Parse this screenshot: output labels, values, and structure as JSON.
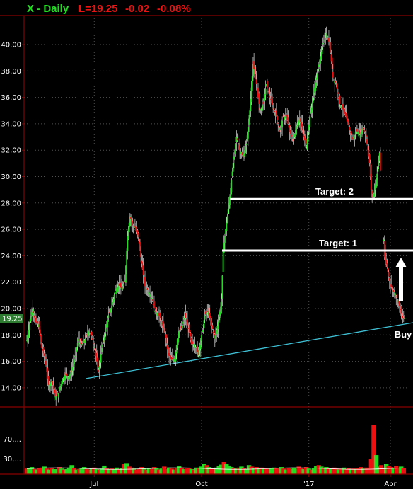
{
  "header": {
    "symbol_label": "X - Daily",
    "last_label": "L=19.25",
    "change": "-0.02",
    "change_pct": "-0.08%"
  },
  "colors": {
    "background": "#000000",
    "up": "#22dd22",
    "down": "#ee1111",
    "frame": "#8b0000",
    "grid": "#505050",
    "trendline": "#3fc1d6",
    "price_tag_bg": "#2e7d32",
    "annotation": "#ffffff"
  },
  "chart_data": {
    "type": "candlestick",
    "title": "X - Daily",
    "y_ticks": [
      "14.00",
      "16.00",
      "18.00",
      "20.00",
      "22.00",
      "24.00",
      "26.00",
      "28.00",
      "30.00",
      "32.00",
      "34.00",
      "36.00",
      "38.00",
      "40.00"
    ],
    "ylim": [
      12.6,
      42.2
    ],
    "x_ticks": [
      "Jul",
      "Oct",
      "'17",
      "Apr"
    ],
    "last_price": "19.25",
    "price_path": [
      [
        0,
        17.6
      ],
      [
        4,
        19.2
      ],
      [
        7,
        20.0
      ],
      [
        10,
        19.0
      ],
      [
        14,
        18.8
      ],
      [
        18,
        17.0
      ],
      [
        22,
        16.2
      ],
      [
        26,
        14.2
      ],
      [
        30,
        14.5
      ],
      [
        34,
        13.3
      ],
      [
        38,
        13.6
      ],
      [
        42,
        14.5
      ],
      [
        46,
        15.0
      ],
      [
        50,
        14.8
      ],
      [
        54,
        15.3
      ],
      [
        58,
        16.4
      ],
      [
        62,
        17.7
      ],
      [
        66,
        17.2
      ],
      [
        70,
        17.7
      ],
      [
        74,
        18.3
      ],
      [
        78,
        17.9
      ],
      [
        82,
        16.8
      ],
      [
        86,
        15.2
      ],
      [
        90,
        17.0
      ],
      [
        94,
        18.1
      ],
      [
        98,
        19.5
      ],
      [
        102,
        20.2
      ],
      [
        106,
        21.3
      ],
      [
        110,
        21.8
      ],
      [
        114,
        21.5
      ],
      [
        118,
        22.1
      ],
      [
        121,
        25.5
      ],
      [
        124,
        27.0
      ],
      [
        127,
        26.3
      ],
      [
        130,
        26.2
      ],
      [
        134,
        25.4
      ],
      [
        138,
        23.4
      ],
      [
        142,
        21.7
      ],
      [
        146,
        21.3
      ],
      [
        150,
        20.8
      ],
      [
        154,
        19.8
      ],
      [
        158,
        19.6
      ],
      [
        162,
        18.9
      ],
      [
        166,
        18.2
      ],
      [
        170,
        16.5
      ],
      [
        174,
        16.1
      ],
      [
        178,
        16.2
      ],
      [
        182,
        18.2
      ],
      [
        186,
        18.5
      ],
      [
        190,
        19.5
      ],
      [
        194,
        18.5
      ],
      [
        198,
        17.3
      ],
      [
        202,
        17.3
      ],
      [
        206,
        16.5
      ],
      [
        210,
        18.0
      ],
      [
        214,
        19.5
      ],
      [
        218,
        19.8
      ],
      [
        222,
        18.7
      ],
      [
        226,
        17.7
      ],
      [
        230,
        19.0
      ],
      [
        234,
        20.5
      ],
      [
        236,
        24.5
      ],
      [
        240,
        26.5
      ],
      [
        244,
        28.5
      ],
      [
        248,
        31.0
      ],
      [
        252,
        33.0
      ],
      [
        256,
        32.0
      ],
      [
        260,
        31.5
      ],
      [
        264,
        32.5
      ],
      [
        268,
        35.0
      ],
      [
        272,
        38.5
      ],
      [
        276,
        37.0
      ],
      [
        280,
        35.0
      ],
      [
        284,
        35.5
      ],
      [
        288,
        37.0
      ],
      [
        292,
        36.0
      ],
      [
        296,
        35.2
      ],
      [
        300,
        34.6
      ],
      [
        304,
        33.4
      ],
      [
        308,
        34.5
      ],
      [
        312,
        34.6
      ],
      [
        316,
        33.4
      ],
      [
        320,
        32.7
      ],
      [
        324,
        33.8
      ],
      [
        328,
        34.4
      ],
      [
        332,
        33.2
      ],
      [
        336,
        32.3
      ],
      [
        340,
        34.5
      ],
      [
        344,
        36.0
      ],
      [
        348,
        37.5
      ],
      [
        352,
        38.8
      ],
      [
        356,
        40.1
      ],
      [
        360,
        40.9
      ],
      [
        364,
        40.0
      ],
      [
        368,
        37.5
      ],
      [
        372,
        37.0
      ],
      [
        376,
        35.5
      ],
      [
        380,
        35.1
      ],
      [
        384,
        34.4
      ],
      [
        388,
        33.5
      ],
      [
        392,
        32.8
      ],
      [
        396,
        33.5
      ],
      [
        400,
        33.2
      ],
      [
        404,
        33.8
      ],
      [
        408,
        33.0
      ],
      [
        412,
        31.0
      ],
      [
        414,
        29.0
      ],
      [
        416,
        28.4
      ],
      [
        418,
        29.0
      ],
      [
        421,
        30.2
      ],
      [
        424,
        31.8
      ],
      [
        430,
        23.9
      ],
      [
        433,
        23.1
      ],
      [
        436,
        22.1
      ],
      [
        439,
        21.4
      ],
      [
        442,
        21.2
      ],
      [
        445,
        20.8
      ],
      [
        448,
        20.2
      ],
      [
        451,
        19.3
      ],
      [
        454,
        19.25
      ]
    ],
    "volume_ticks": [
      "30,...",
      "70,..."
    ],
    "volume_ylim": [
      0,
      110
    ],
    "volume_bars": [
      [
        0,
        11,
        0
      ],
      [
        3,
        12,
        1
      ],
      [
        6,
        14,
        1
      ],
      [
        9,
        10,
        0
      ],
      [
        12,
        9,
        1
      ],
      [
        15,
        12,
        0
      ],
      [
        18,
        13,
        0
      ],
      [
        21,
        15,
        1
      ],
      [
        24,
        11,
        0
      ],
      [
        27,
        9,
        1
      ],
      [
        30,
        12,
        0
      ],
      [
        33,
        10,
        1
      ],
      [
        36,
        9,
        1
      ],
      [
        39,
        14,
        0
      ],
      [
        42,
        11,
        1
      ],
      [
        45,
        9,
        0
      ],
      [
        48,
        10,
        1
      ],
      [
        51,
        13,
        1
      ],
      [
        54,
        18,
        1
      ],
      [
        57,
        12,
        0
      ],
      [
        60,
        9,
        1
      ],
      [
        63,
        10,
        0
      ],
      [
        66,
        11,
        1
      ],
      [
        69,
        14,
        1
      ],
      [
        72,
        10,
        0
      ],
      [
        75,
        9,
        0
      ],
      [
        78,
        11,
        1
      ],
      [
        81,
        13,
        0
      ],
      [
        84,
        10,
        1
      ],
      [
        87,
        9,
        0
      ],
      [
        90,
        11,
        1
      ],
      [
        93,
        17,
        1
      ],
      [
        96,
        12,
        0
      ],
      [
        99,
        10,
        1
      ],
      [
        102,
        11,
        0
      ],
      [
        105,
        9,
        1
      ],
      [
        108,
        13,
        1
      ],
      [
        111,
        10,
        0
      ],
      [
        114,
        12,
        1
      ],
      [
        117,
        20,
        0
      ],
      [
        120,
        22,
        1
      ],
      [
        123,
        15,
        0
      ],
      [
        126,
        13,
        0
      ],
      [
        129,
        11,
        1
      ],
      [
        132,
        9,
        0
      ],
      [
        135,
        10,
        0
      ],
      [
        138,
        14,
        0
      ],
      [
        141,
        11,
        1
      ],
      [
        144,
        9,
        0
      ],
      [
        147,
        12,
        1
      ],
      [
        150,
        10,
        0
      ],
      [
        153,
        14,
        0
      ],
      [
        156,
        12,
        1
      ],
      [
        159,
        9,
        0
      ],
      [
        162,
        11,
        1
      ],
      [
        165,
        15,
        0
      ],
      [
        168,
        10,
        0
      ],
      [
        171,
        13,
        1
      ],
      [
        174,
        11,
        0
      ],
      [
        177,
        9,
        1
      ],
      [
        180,
        12,
        0
      ],
      [
        183,
        16,
        1
      ],
      [
        186,
        13,
        0
      ],
      [
        189,
        10,
        1
      ],
      [
        192,
        11,
        0
      ],
      [
        195,
        12,
        0
      ],
      [
        198,
        10,
        1
      ],
      [
        201,
        9,
        0
      ],
      [
        204,
        13,
        1
      ],
      [
        207,
        11,
        0
      ],
      [
        210,
        15,
        1
      ],
      [
        213,
        20,
        1
      ],
      [
        216,
        18,
        0
      ],
      [
        219,
        14,
        1
      ],
      [
        222,
        12,
        0
      ],
      [
        225,
        10,
        0
      ],
      [
        228,
        13,
        1
      ],
      [
        231,
        16,
        1
      ],
      [
        234,
        19,
        1
      ],
      [
        237,
        24,
        0
      ],
      [
        240,
        21,
        1
      ],
      [
        243,
        17,
        1
      ],
      [
        246,
        14,
        1
      ],
      [
        249,
        12,
        0
      ],
      [
        252,
        11,
        1
      ],
      [
        255,
        13,
        0
      ],
      [
        258,
        15,
        1
      ],
      [
        261,
        12,
        0
      ],
      [
        264,
        10,
        1
      ],
      [
        267,
        18,
        1
      ],
      [
        270,
        15,
        0
      ],
      [
        273,
        12,
        1
      ],
      [
        276,
        14,
        0
      ],
      [
        279,
        11,
        1
      ],
      [
        282,
        13,
        0
      ],
      [
        285,
        10,
        1
      ],
      [
        288,
        12,
        0
      ],
      [
        291,
        9,
        0
      ],
      [
        294,
        11,
        1
      ],
      [
        297,
        13,
        1
      ],
      [
        300,
        12,
        0
      ],
      [
        303,
        10,
        0
      ],
      [
        306,
        14,
        1
      ],
      [
        309,
        11,
        0
      ],
      [
        312,
        9,
        1
      ],
      [
        315,
        12,
        0
      ],
      [
        318,
        10,
        0
      ],
      [
        321,
        13,
        1
      ],
      [
        324,
        11,
        1
      ],
      [
        327,
        15,
        0
      ],
      [
        330,
        12,
        0
      ],
      [
        333,
        10,
        1
      ],
      [
        336,
        14,
        0
      ],
      [
        339,
        11,
        1
      ],
      [
        342,
        9,
        0
      ],
      [
        345,
        12,
        1
      ],
      [
        348,
        16,
        1
      ],
      [
        351,
        18,
        0
      ],
      [
        354,
        15,
        1
      ],
      [
        357,
        13,
        0
      ],
      [
        360,
        14,
        1
      ],
      [
        363,
        11,
        0
      ],
      [
        366,
        10,
        1
      ],
      [
        369,
        13,
        0
      ],
      [
        372,
        12,
        0
      ],
      [
        375,
        9,
        1
      ],
      [
        378,
        11,
        0
      ],
      [
        381,
        13,
        1
      ],
      [
        384,
        10,
        0
      ],
      [
        387,
        12,
        0
      ],
      [
        390,
        9,
        1
      ],
      [
        393,
        11,
        0
      ],
      [
        396,
        10,
        1
      ],
      [
        399,
        12,
        0
      ],
      [
        402,
        14,
        0
      ],
      [
        405,
        11,
        1
      ],
      [
        408,
        13,
        0
      ],
      [
        411,
        12,
        0
      ],
      [
        414,
        30,
        0
      ],
      [
        417,
        98,
        0
      ],
      [
        420,
        38,
        1
      ],
      [
        423,
        15,
        1
      ],
      [
        426,
        18,
        0
      ],
      [
        429,
        13,
        0
      ],
      [
        432,
        20,
        1
      ],
      [
        435,
        17,
        0
      ],
      [
        438,
        14,
        0
      ],
      [
        441,
        11,
        1
      ],
      [
        444,
        16,
        0
      ],
      [
        447,
        13,
        0
      ],
      [
        450,
        15,
        1
      ],
      [
        453,
        12,
        0
      ]
    ]
  },
  "annotations": {
    "target1_label": "Target: 1",
    "target1_price": 24.4,
    "target2_label": "Target: 2",
    "target2_price": 28.3,
    "buy_label": "Buy"
  }
}
